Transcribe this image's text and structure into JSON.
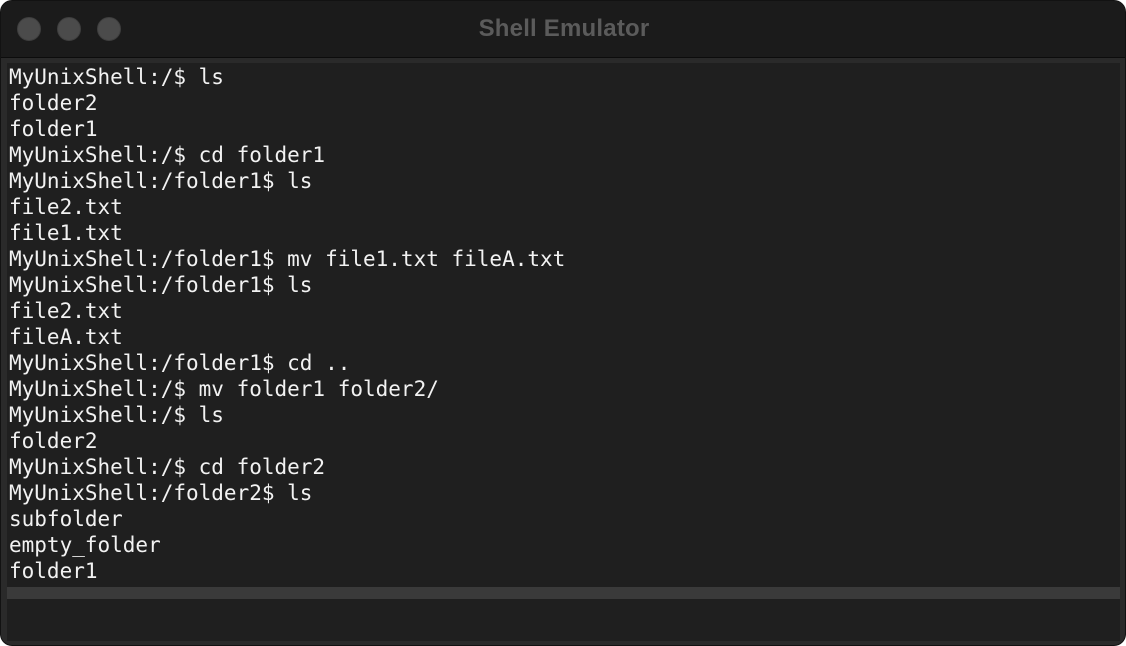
{
  "window": {
    "title": "Shell Emulator",
    "traffic_lights": [
      "close",
      "minimize",
      "zoom"
    ]
  },
  "terminal": {
    "lines": [
      "MyUnixShell:/$ ls",
      "folder2",
      "folder1",
      "MyUnixShell:/$ cd folder1",
      "MyUnixShell:/folder1$ ls",
      "file2.txt",
      "file1.txt",
      "MyUnixShell:/folder1$ mv file1.txt fileA.txt",
      "MyUnixShell:/folder1$ ls",
      "file2.txt",
      "fileA.txt",
      "MyUnixShell:/folder1$ cd ..",
      "MyUnixShell:/$ mv folder1 folder2/",
      "MyUnixShell:/$ ls",
      "folder2",
      "MyUnixShell:/$ cd folder2",
      "MyUnixShell:/folder2$ ls",
      "subfolder",
      "empty_folder",
      "folder1"
    ]
  },
  "input": {
    "value": "",
    "placeholder": ""
  },
  "colors": {
    "titlebar": "#1b1b1b",
    "title_text": "#5b5b5b",
    "terminal_bg": "#1f1f1f",
    "terminal_text": "#f2f2f2",
    "separator": "#3a3a3a",
    "traffic_light": "#4b4b4b"
  }
}
